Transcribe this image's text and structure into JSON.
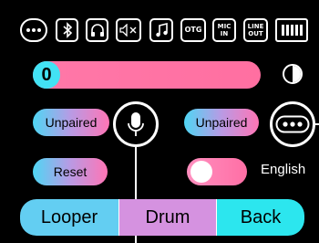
{
  "status_bar": {
    "icons": [
      {
        "name": "dots-pill-icon"
      },
      {
        "name": "bluetooth-icon"
      },
      {
        "name": "headphones-icon"
      },
      {
        "name": "speaker-mute-icon"
      },
      {
        "name": "music-note-icon"
      },
      {
        "name": "otg-icon",
        "label": "OTG"
      },
      {
        "name": "mic-in-icon",
        "label_line1": "MIC",
        "label_line2": "IN"
      },
      {
        "name": "line-out-icon",
        "label_line1": "LINE",
        "label_line2": "OUT"
      },
      {
        "name": "battery-icon",
        "level_fraction": 1.0
      }
    ]
  },
  "volume": {
    "value": "0",
    "level_fraction": 0.0,
    "color": "#ff6fa1",
    "knob_color": "#42e2f4"
  },
  "left_pair": {
    "label": "Unpaired"
  },
  "right_pair": {
    "label": "Unpaired"
  },
  "reset": {
    "label": "Reset"
  },
  "language": {
    "label": "English",
    "toggle_on": false
  },
  "tabs": {
    "looper": "Looper",
    "drum": "Drum",
    "back": "Back"
  },
  "colors": {
    "tab_looper": "#63cef2",
    "tab_drum": "#d592e0",
    "tab_back": "#2ce6ee"
  }
}
